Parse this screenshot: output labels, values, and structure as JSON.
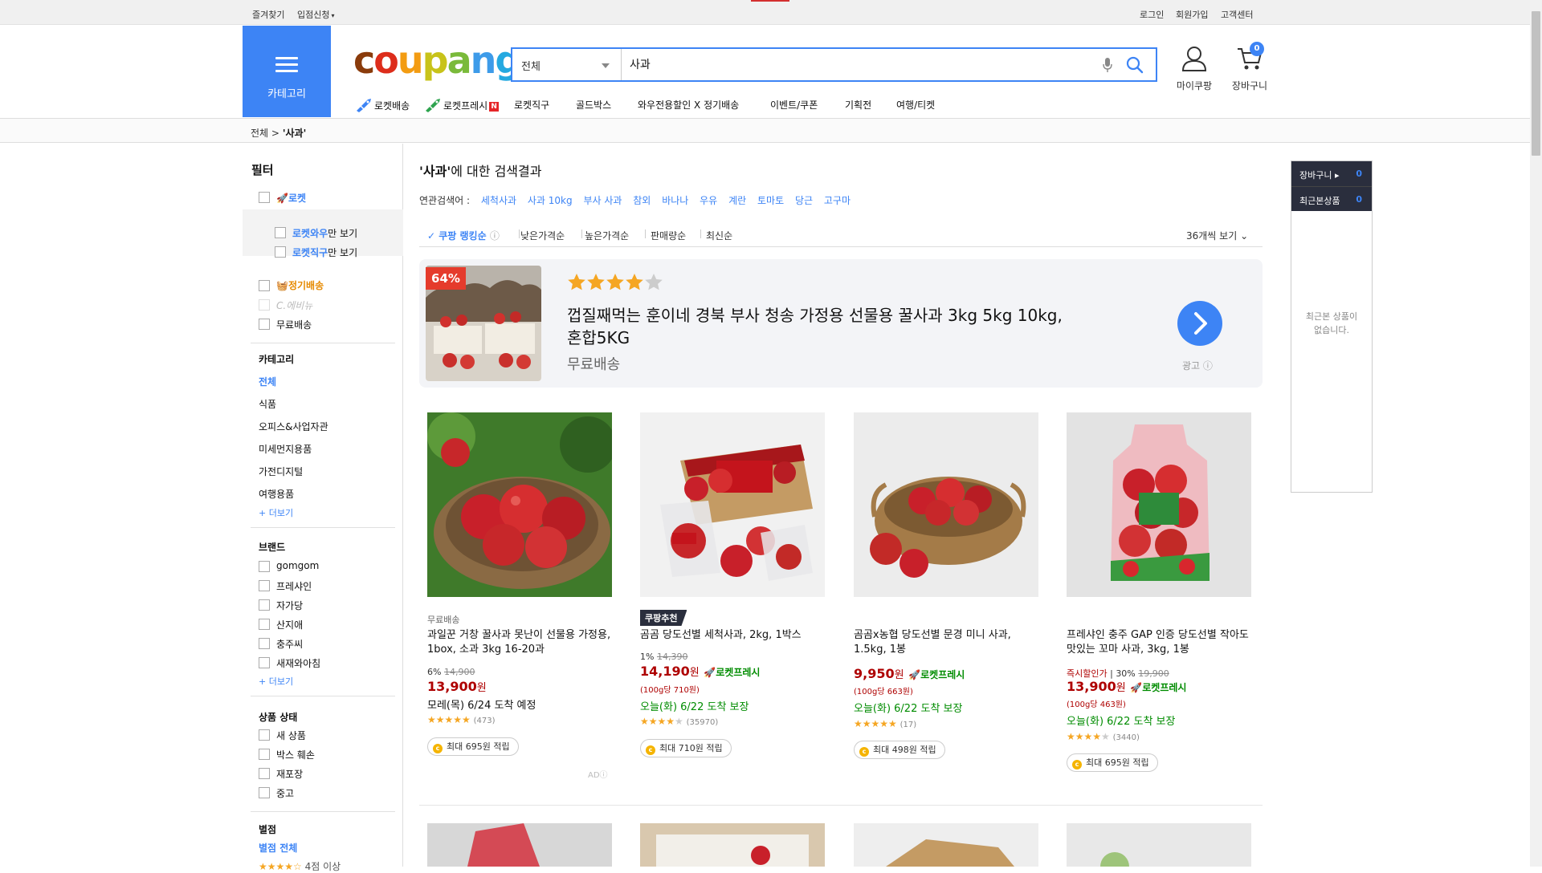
{
  "topbar": {
    "bookmark": "즐겨찾기",
    "seller": "입점신청",
    "login": "로그인",
    "signup": "회원가입",
    "cs": "고객센터"
  },
  "category_button": {
    "label": "카테고리"
  },
  "logo": {
    "text": "coupang",
    "colors": [
      "#8a3b0b",
      "#dd2d1b",
      "#f39c12",
      "#7aba3a",
      "#3d9be9",
      "#2ea2e4",
      "#25a9e0"
    ]
  },
  "search": {
    "category": "전체",
    "query": "사과"
  },
  "header": {
    "mycoupang": "마이쿠팡",
    "cart": "장바구니",
    "cart_count": "0"
  },
  "nav": [
    "로켓배송",
    "로켓프레시",
    "로켓직구",
    "골드박스",
    "와우전용할인 X 정기배송",
    "이벤트/쿠폰",
    "기획전",
    "여행/티켓"
  ],
  "nav_badge": "N",
  "breadcrumb": {
    "root": "전체",
    "sep": ">",
    "current": "'사과'"
  },
  "filter": {
    "title": "필터",
    "rocket": "로켓",
    "rocket_wow": "로켓와우",
    "rocket_wow_suffix": "만 보기",
    "rocket_jikgu": "로켓직구",
    "rocket_jikgu_suffix": "만 보기",
    "regular": "정기배송",
    "early": "C.에비뉴",
    "free": "무료배송",
    "category_title": "카테고리",
    "categories": [
      "전체",
      "식품",
      "오피스&사업자관",
      "미세먼지용품",
      "가전디지털",
      "여행용품"
    ],
    "more": "+ 더보기",
    "brand_title": "브랜드",
    "brands": [
      "gomgom",
      "프레샤인",
      "자가당",
      "산지애",
      "충주씨",
      "새재와아침"
    ],
    "condition_title": "상품 상태",
    "conditions": [
      "새 상품",
      "박스 훼손",
      "재포장",
      "중고"
    ],
    "rating_title": "별점",
    "rating_all": "별점 전체",
    "rating_4": "4점 이상"
  },
  "results": {
    "quote": "'사과'",
    "title_suffix": "에 대한 검색결과"
  },
  "related": {
    "label": "연관검색어 :",
    "items": [
      "세척사과",
      "사과 10kg",
      "부사 사과",
      "참외",
      "바나나",
      "우유",
      "계란",
      "토마토",
      "당근",
      "고구마"
    ]
  },
  "sort": {
    "options": [
      "쿠팡 랭킹순",
      "낮은가격순",
      "높은가격순",
      "판매량순",
      "최신순"
    ],
    "view": "36개씩 보기"
  },
  "ad": {
    "discount": "64%",
    "rating": 4,
    "title": "껍질째먹는 훈이네 경북 부사 청송 가정용 선물용 꿀사과 3kg 5kg 10kg, 혼합5KG",
    "shipping": "무료배송",
    "label": "광고"
  },
  "products": [
    {
      "tag": "무료배송",
      "name": "과일꾼 거창 꿀사과 못난이 선물용 가정용, 1box, 소과 3kg 16-20과",
      "disc": "6%",
      "orig": "14,900",
      "price": "13,900",
      "won": "원",
      "arrival": "모레(목) 6/24 도착 예정",
      "rating": 4.5,
      "reviews": "(473)",
      "cash": "최대 695원 적립",
      "ad": "AD"
    },
    {
      "badge": "쿠팡추천",
      "name": "곰곰 당도선별 세척사과, 2kg, 1박스",
      "disc": "1%",
      "orig": "14,390",
      "price": "14,190",
      "won": "원",
      "fresh": "로켓프레시",
      "unit": "(100g당 710원)",
      "arrival": "오늘(화) 6/22 도착 보장",
      "rating": 4,
      "reviews": "(35970)",
      "cash": "최대 710원 적립"
    },
    {
      "name": "곰곰x농협 당도선별 문경 미니 사과, 1.5kg, 1봉",
      "price": "9,950",
      "won": "원",
      "fresh": "로켓프레시",
      "unit": "(100g당 663원)",
      "arrival": "오늘(화) 6/22 도착 보장",
      "rating": 5,
      "reviews": "(17)",
      "cash": "최대 498원 적립"
    },
    {
      "name": "프레샤인 충주 GAP 인증 당도선별 작아도 맛있는 꼬마 사과, 3kg, 1봉",
      "instant": "즉시할인가",
      "disc": "30%",
      "orig": "19,900",
      "price": "13,900",
      "won": "원",
      "fresh": "로켓프레시",
      "unit": "(100g당 463원)",
      "arrival": "오늘(화) 6/22 도착 보장",
      "rating": 4,
      "reviews": "(3440)",
      "cash": "최대 695원 적립"
    }
  ],
  "right_panel": {
    "cart": "장바구니",
    "cart_count": "0",
    "recent": "최근본상품",
    "recent_count": "0",
    "empty_line1": "최근본 상품이",
    "empty_line2": "없습니다."
  },
  "colors": {
    "accent": "#3d84f5",
    "price_red": "#ae0000",
    "fresh_green": "#008c00",
    "star": "#f5a623"
  }
}
